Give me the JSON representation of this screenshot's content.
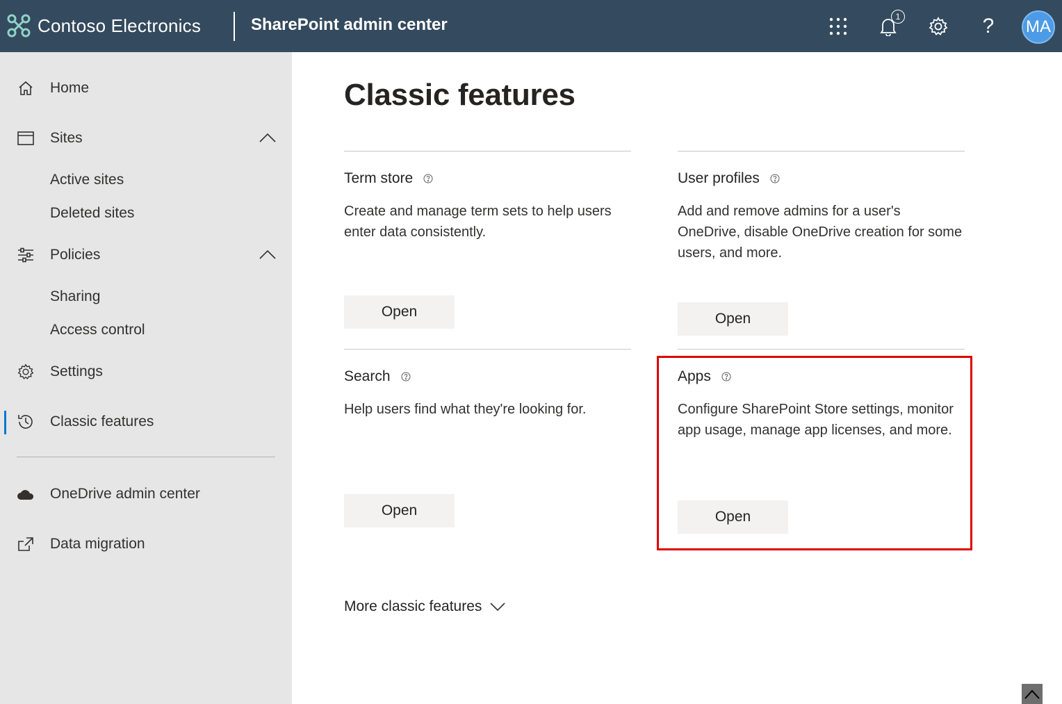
{
  "header": {
    "org_name": "Contoso Electronics",
    "app_title": "SharePoint admin center",
    "notification_count": "1",
    "help_glyph": "?",
    "avatar_initials": "MA",
    "icons": [
      "app-launcher-icon",
      "bell-icon",
      "gear-icon",
      "help-icon"
    ],
    "colors": {
      "bar": "#344a5e",
      "avatar": "#4d9be6"
    }
  },
  "sidebar": {
    "items": [
      {
        "label": "Home",
        "icon": "home-icon"
      },
      {
        "label": "Sites",
        "icon": "browser-icon",
        "expanded": true,
        "children": [
          "Active sites",
          "Deleted sites"
        ]
      },
      {
        "label": "Policies",
        "icon": "sliders-icon",
        "expanded": true,
        "children": [
          "Sharing",
          "Access control"
        ]
      },
      {
        "label": "Settings",
        "icon": "gear-icon"
      },
      {
        "label": "Classic features",
        "icon": "history-icon",
        "active": true
      },
      {
        "label": "OneDrive admin center",
        "icon": "cloud-icon"
      },
      {
        "label": "Data migration",
        "icon": "external-link-icon"
      }
    ],
    "active_color": "#0078d4"
  },
  "main": {
    "title": "Classic features",
    "cards": [
      {
        "title": "Term store",
        "description": "Create and manage term sets to help users enter data consistently.",
        "button": "Open"
      },
      {
        "title": "User profiles",
        "description": "Add and remove admins for a user's OneDrive, disable OneDrive creation for some users, and more.",
        "button": "Open"
      },
      {
        "title": "Search",
        "description": "Help users find what they're looking for.",
        "button": "Open"
      },
      {
        "title": "Apps",
        "description": "Configure SharePoint Store settings, monitor app usage, manage app licenses, and more.",
        "button": "Open",
        "highlighted": true
      }
    ],
    "more_label": "More classic features",
    "highlight_color": "#e00000"
  }
}
